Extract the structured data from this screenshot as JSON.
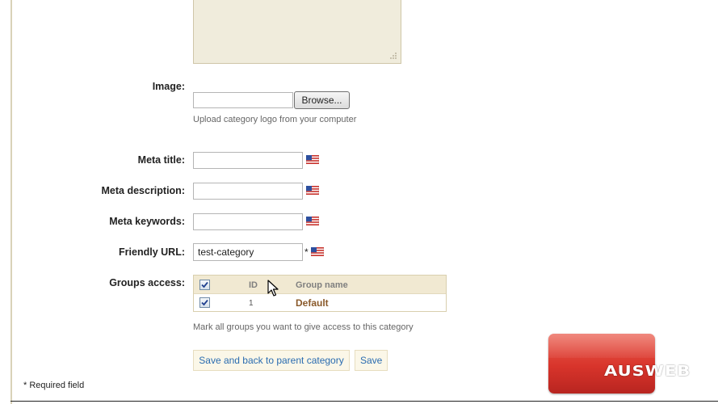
{
  "form": {
    "image": {
      "label": "Image:",
      "browse_label": "Browse...",
      "hint": "Upload category logo from your computer"
    },
    "meta_title": {
      "label": "Meta title:",
      "value": ""
    },
    "meta_description": {
      "label": "Meta description:",
      "value": ""
    },
    "meta_keywords": {
      "label": "Meta keywords:",
      "value": ""
    },
    "friendly_url": {
      "label": "Friendly URL:",
      "value": "test-category",
      "required_mark": "*"
    },
    "groups_access": {
      "label": "Groups access:",
      "columns": {
        "id": "ID",
        "name": "Group name"
      },
      "rows": [
        {
          "id": "1",
          "name": "Default",
          "checked": true
        }
      ],
      "hint": "Mark all groups you want to give access to this category"
    },
    "buttons": {
      "save_back": "Save and back to parent category",
      "save": "Save"
    },
    "required_note": "* Required field"
  },
  "language_flag": "us-flag-icon",
  "watermark": {
    "text": "AUSWEB"
  },
  "colors": {
    "accent_link": "#2a6cb0",
    "group_name": "#8a5a2b",
    "table_header_bg": "#f1e9d2",
    "textarea_bg": "#f0ecdc",
    "logo_red": "#d8342b"
  }
}
